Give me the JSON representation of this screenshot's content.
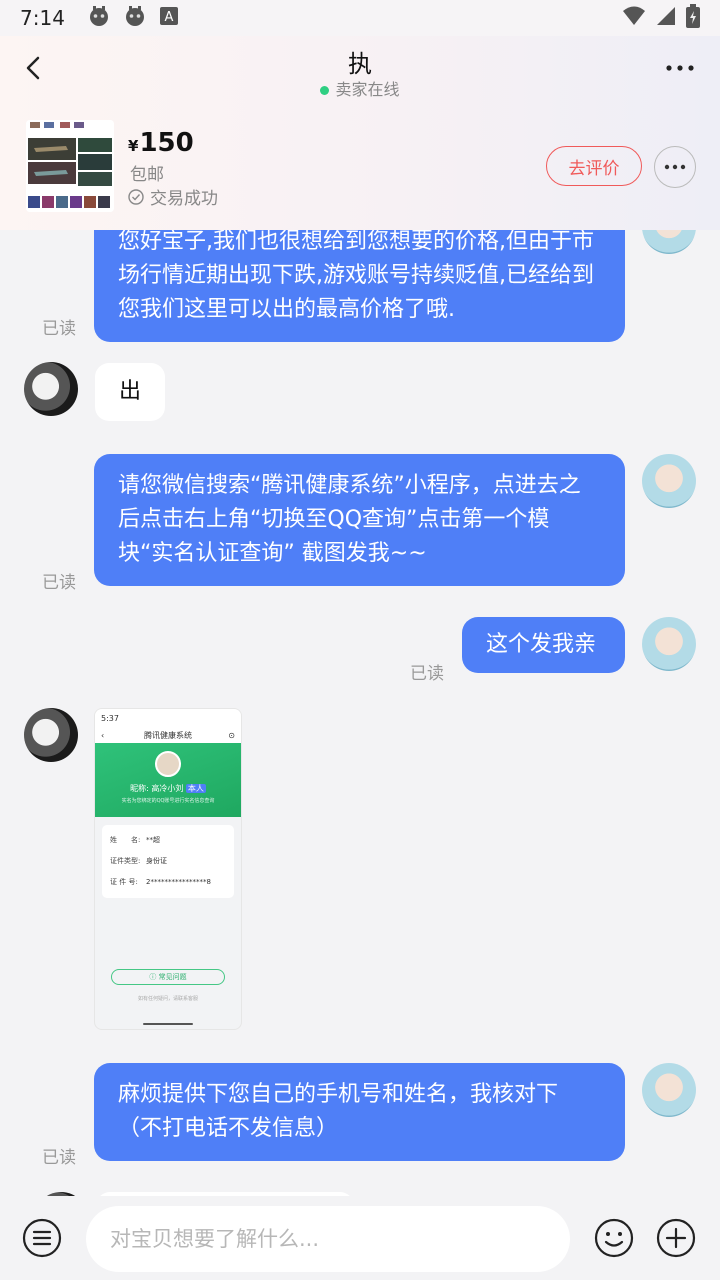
{
  "status_bar": {
    "time": "7:14",
    "letter_badge": "A"
  },
  "header": {
    "title": "执",
    "online_status": "卖家在线"
  },
  "product": {
    "currency": "¥",
    "price": "150",
    "shipping": "包邮",
    "trade_status": "交易成功",
    "review_button": "去评价"
  },
  "messages": {
    "m1_text": "您好宝子,我们也很想给到您想要的价格,但由于市场行情近期出现下跌,游戏账号持续贬值,已经给到您我们这里可以出的最高价格了哦.",
    "m1_read": "已读",
    "m2_text": "出",
    "m3_text": "请您微信搜索“腾讯健康系统”小程序，点进去之后点击右上角“切换至QQ查询”点击第一个模块“实名认证查询” 截图发我~~",
    "m3_read": "已读",
    "m4_text": "这个发我亲",
    "m4_read": "已读",
    "m6_text": "麻烦提供下您自己的手机号和姓名，我核对下（不打电话不发信息）",
    "m6_read": "已读"
  },
  "screenshot": {
    "time": "5:37",
    "nav_title": "腾讯健康系统",
    "profile_name": "昵称: 高冷小刘",
    "profile_tag": "本人",
    "profile_sub": "实名为您绑定的QQ账号进行实名信息查询",
    "name_label": "姓　　名:",
    "name_value": "**超",
    "id_type_label": "证件类型:",
    "id_type_value": "身份证",
    "id_no_label": "证 件 号:",
    "id_no_value": "2****************8",
    "help_button": "常见问题",
    "footer_note": "如有任何疑问，请联系客服"
  },
  "composer": {
    "placeholder": "对宝贝想要了解什么..."
  },
  "colors": {
    "my_bubble": "#4f7ff7",
    "review_accent": "#f05a5a",
    "online_dot": "#2fcf82"
  }
}
